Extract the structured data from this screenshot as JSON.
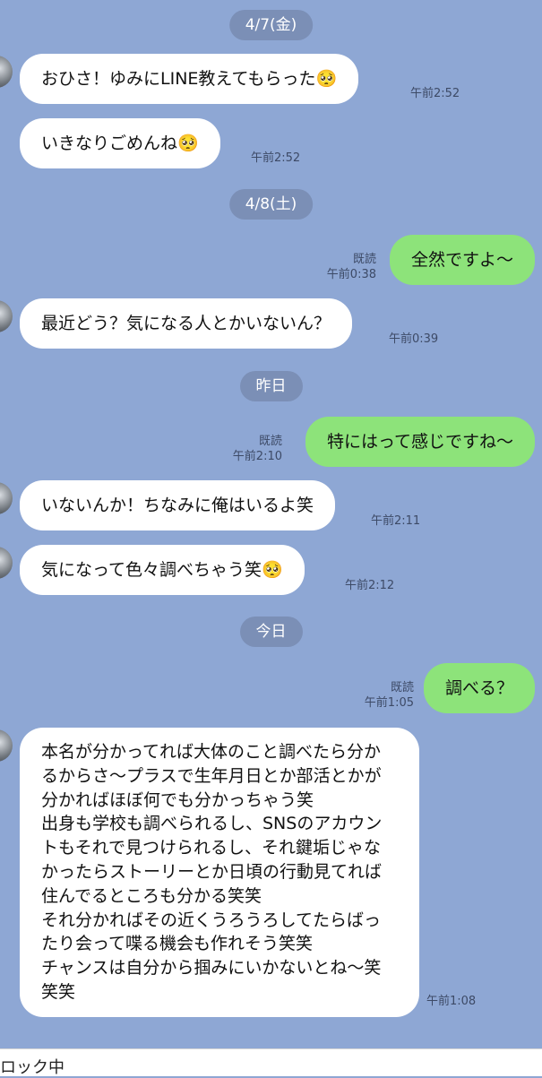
{
  "dates": [
    "4/7(金)",
    "4/8(土)",
    "昨日",
    "今日"
  ],
  "messages": [
    {
      "text": "おひさ！ゆみにLINE教えてもらった🥺",
      "time": "午前2:52"
    },
    {
      "text": "いきなりごめんね🥺",
      "time": "午前2:52"
    },
    {
      "text": "全然ですよ〜",
      "time": "午前0:38",
      "read": "既読"
    },
    {
      "text": "最近どう？気になる人とかいないん？",
      "time": "午前0:39"
    },
    {
      "text": "特にはって感じですね〜",
      "time": "午前2:10",
      "read": "既読"
    },
    {
      "text": "いないんか！ちなみに俺はいるよ笑",
      "time": "午前2:11"
    },
    {
      "text": "気になって色々調べちゃう笑🥺",
      "time": "午前2:12"
    },
    {
      "text": "調べる？",
      "time": "午前1:05",
      "read": "既読"
    },
    {
      "text": "本名が分かってれば大体のこと調べたら分かるからさ〜プラスで生年月日とか部活とかが分かればほぼ何でも分かっちゃう笑\n出身も学校も調べられるし、SNSのアカウントもそれで見つけられるし、それ鍵垢じゃなかったらストーリーとか日頃の行動見てれば住んでるところも分かる笑笑\nそれ分かればその近くうろうろしてたらばったり会って喋る機会も作れそう笑笑\nチャンスは自分から掴みにいかないとね〜笑笑笑",
      "time": "午前1:08"
    }
  ],
  "bottom_bar": {
    "text": "ロック中"
  },
  "colors": {
    "background": "#8ea7d4",
    "incoming": "#ffffff",
    "outgoing": "#8de37a",
    "date_pill": "#7b8fb6"
  }
}
